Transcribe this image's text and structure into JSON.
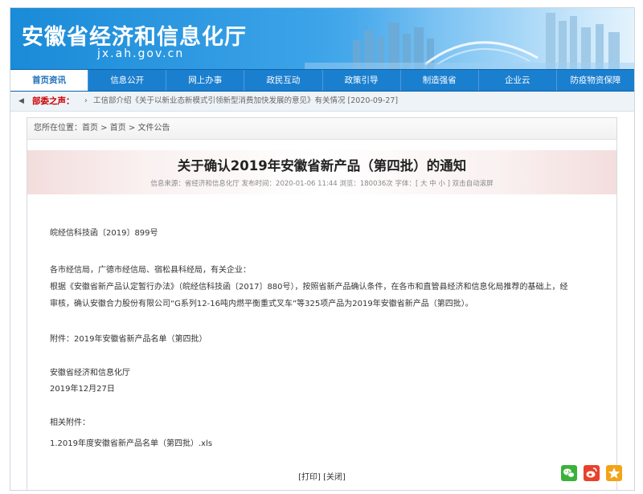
{
  "header": {
    "site_title": "安徽省经济和信息化厅",
    "site_url": "jx.ah.gov.cn"
  },
  "nav": {
    "items": [
      "首页资讯",
      "信息公开",
      "网上办事",
      "政民互动",
      "政策引导",
      "制造强省",
      "企业云",
      "防疫物资保障"
    ]
  },
  "ticker": {
    "label": "部委之声：",
    "text": "工信部介绍《关于以新业态新模式引领新型消费加快发展的意见》有关情况 [2020-09-27]"
  },
  "breadcrumb": "您所在位置：首页 > 首页 > 文件公告",
  "article": {
    "title": "关于确认2019年安徽省新产品（第四批）的通知",
    "meta": "信息来源：省经济和信息化厅    发布时间：2020-01-06 11:44    浏览：180036次    字体：[ 大 中 小 ]    双击自动滚屏",
    "doc_no": "皖经信科技函〔2019〕899号",
    "salutation": "各市经信局，广德市经信局、宿松县科经局，有关企业：",
    "para_line1": "根据《安徽省新产品认定暂行办法》（皖经信科技函〔2017〕880号），按照省新产品确认条件，在各市和直管县经济和信息化局推荐的基础上，经",
    "para_line2": "审核，确认安徽合力股份有限公司“G系列12-16吨内燃平衡重式叉车”等325项产品为2019年安徽省新产品（第四批）。",
    "attachment": "附件：2019年安徽省新产品名单（第四批）",
    "sign_org": "安徽省经济和信息化厅",
    "sign_date": "2019年12月27日",
    "related_label": "相关附件：",
    "related_file": "1.2019年度安徽省新产品名单（第四批）.xls",
    "footer_links": "[打印] [关闭]"
  },
  "share": {
    "icons": [
      "wechat-icon",
      "weibo-icon",
      "favorite-star-icon"
    ],
    "colors": {
      "wechat": "#3bb13b",
      "weibo": "#e8412c",
      "favorite": "#f3a316"
    }
  }
}
